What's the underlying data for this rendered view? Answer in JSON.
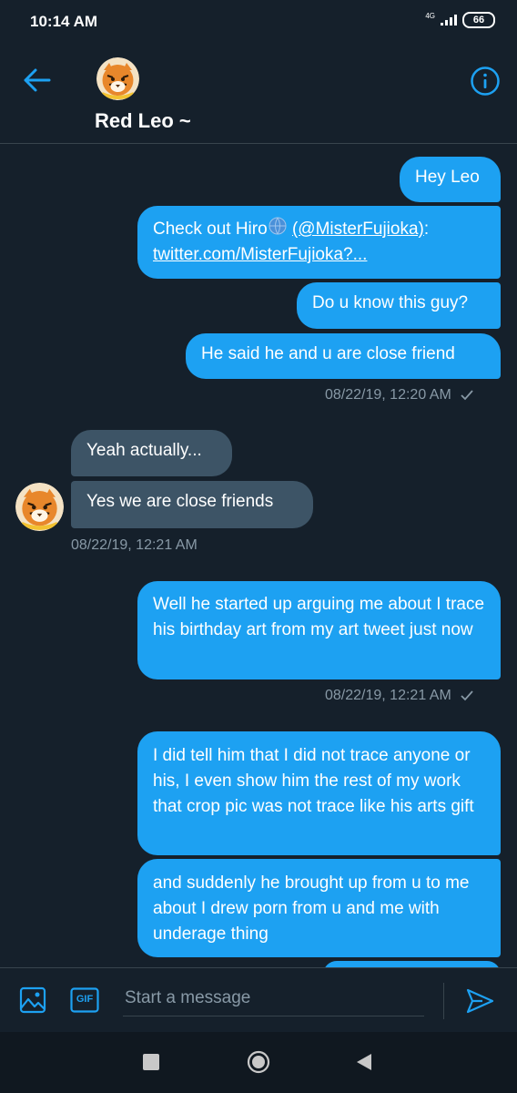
{
  "status_bar": {
    "time": "10:14 AM",
    "network": "4G",
    "battery": "66"
  },
  "header": {
    "contact_name": "Red Leo ~"
  },
  "messages": [
    {
      "side": "sent",
      "text": "Hey Leo"
    },
    {
      "side": "sent",
      "prefix": "Check out Hiro",
      "link1": "(@MisterFujioka)",
      "after_link1": ":",
      "link2": "twitter.com/MisterFujioka?..."
    },
    {
      "side": "sent",
      "text": "Do u know this guy?"
    },
    {
      "side": "sent",
      "text": "He said he and u are close friend"
    },
    {
      "side": "recv",
      "text": "Yeah actually..."
    },
    {
      "side": "recv",
      "text": "Yes we are close friends"
    },
    {
      "side": "sent",
      "text": "Well he started up arguing me about I trace his birthday art from my art tweet just now"
    },
    {
      "side": "sent",
      "text": "I did tell him that I did not trace anyone or his, I even show him the rest of my work that crop pic was not trace like his arts gift"
    },
    {
      "side": "sent",
      "text": "and suddenly he brought up from u to me about I drew porn from u and me with underage thing"
    }
  ],
  "timestamps": {
    "t1": "08/22/19, 12:20 AM",
    "t2": "08/22/19, 12:21 AM",
    "t3": "08/22/19, 12:21 AM"
  },
  "composer": {
    "placeholder": "Start a message",
    "gif_label": "GIF"
  },
  "colors": {
    "accent": "#1da1f2",
    "background": "#15202b",
    "received_bubble": "#3d5466",
    "muted_text": "#8899a6"
  }
}
